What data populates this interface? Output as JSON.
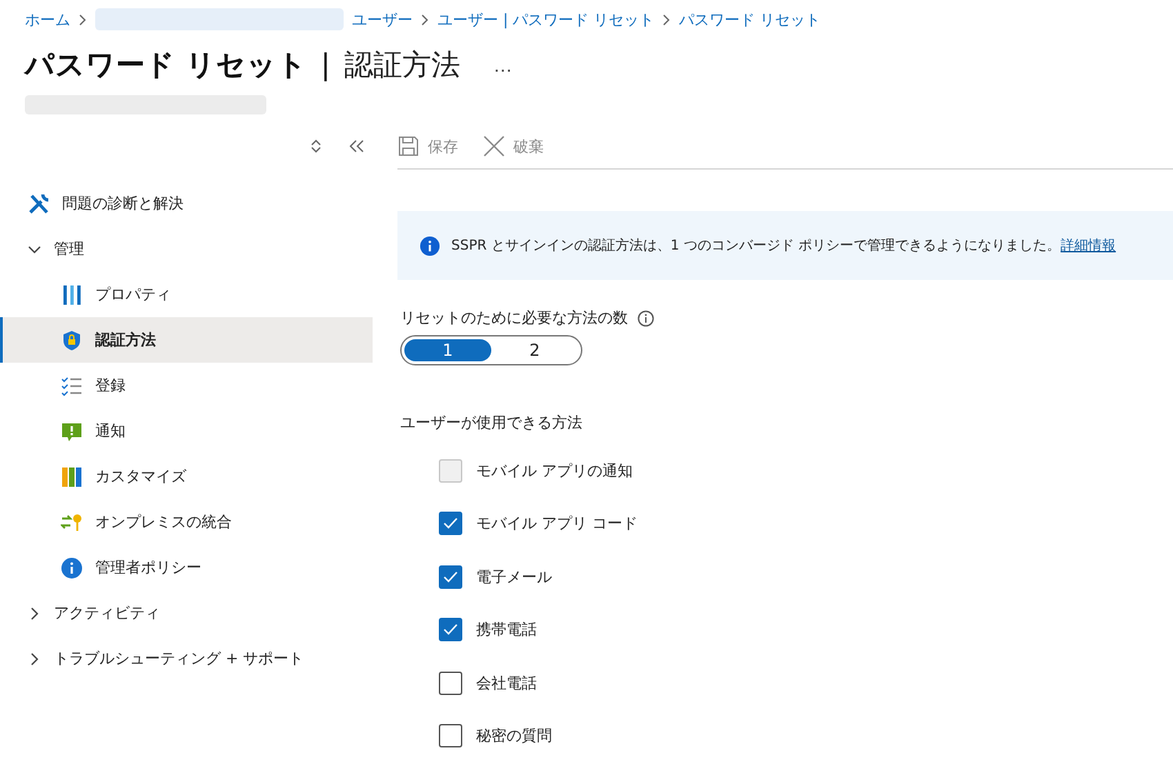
{
  "breadcrumb": [
    {
      "label": "ホーム"
    },
    {
      "label": "ユーザー"
    },
    {
      "label": "ユーザー | パスワード リセット"
    },
    {
      "label": "パスワード リセット"
    }
  ],
  "title": {
    "main": "パスワード リセット",
    "separator": "|",
    "sub": "認証方法",
    "more": "…"
  },
  "sidebar": {
    "items": [
      {
        "label": "問題の診断と解決",
        "selected": false
      },
      {
        "label": "管理",
        "selected": false,
        "expanded": true,
        "children": [
          {
            "label": "プロパティ",
            "selected": false
          },
          {
            "label": "認証方法",
            "selected": true
          },
          {
            "label": "登録",
            "selected": false
          },
          {
            "label": "通知",
            "selected": false
          },
          {
            "label": "カスタマイズ",
            "selected": false
          },
          {
            "label": "オンプレミスの統合",
            "selected": false
          },
          {
            "label": "管理者ポリシー",
            "selected": false
          }
        ]
      },
      {
        "label": "アクティビティ",
        "selected": false,
        "expanded": false
      },
      {
        "label": "トラブルシューティング + サポート",
        "selected": false,
        "expanded": false
      }
    ]
  },
  "toolbar": [
    {
      "label": "保存",
      "disabled": true
    },
    {
      "label": "破棄",
      "disabled": true
    }
  ],
  "banner": {
    "text": "SSPR とサインインの認証方法は、1 つのコンバージド ポリシーで管理できるようになりました。",
    "link": "詳細情報"
  },
  "methods_required": {
    "label": "リセットのために必要な方法の数",
    "options": [
      {
        "label": "1",
        "selected": true
      },
      {
        "label": "2",
        "selected": false
      }
    ]
  },
  "methods_available": {
    "label": "ユーザーが使用できる方法",
    "items": [
      {
        "label": "モバイル アプリの通知",
        "checked": false,
        "disabled": true
      },
      {
        "label": "モバイル アプリ コード",
        "checked": true,
        "disabled": false
      },
      {
        "label": "電子メール",
        "checked": true,
        "disabled": false
      },
      {
        "label": "携帯電話",
        "checked": true,
        "disabled": false
      },
      {
        "label": "会社電話",
        "checked": false,
        "disabled": false
      },
      {
        "label": "秘密の質問",
        "checked": false,
        "disabled": false
      }
    ]
  }
}
